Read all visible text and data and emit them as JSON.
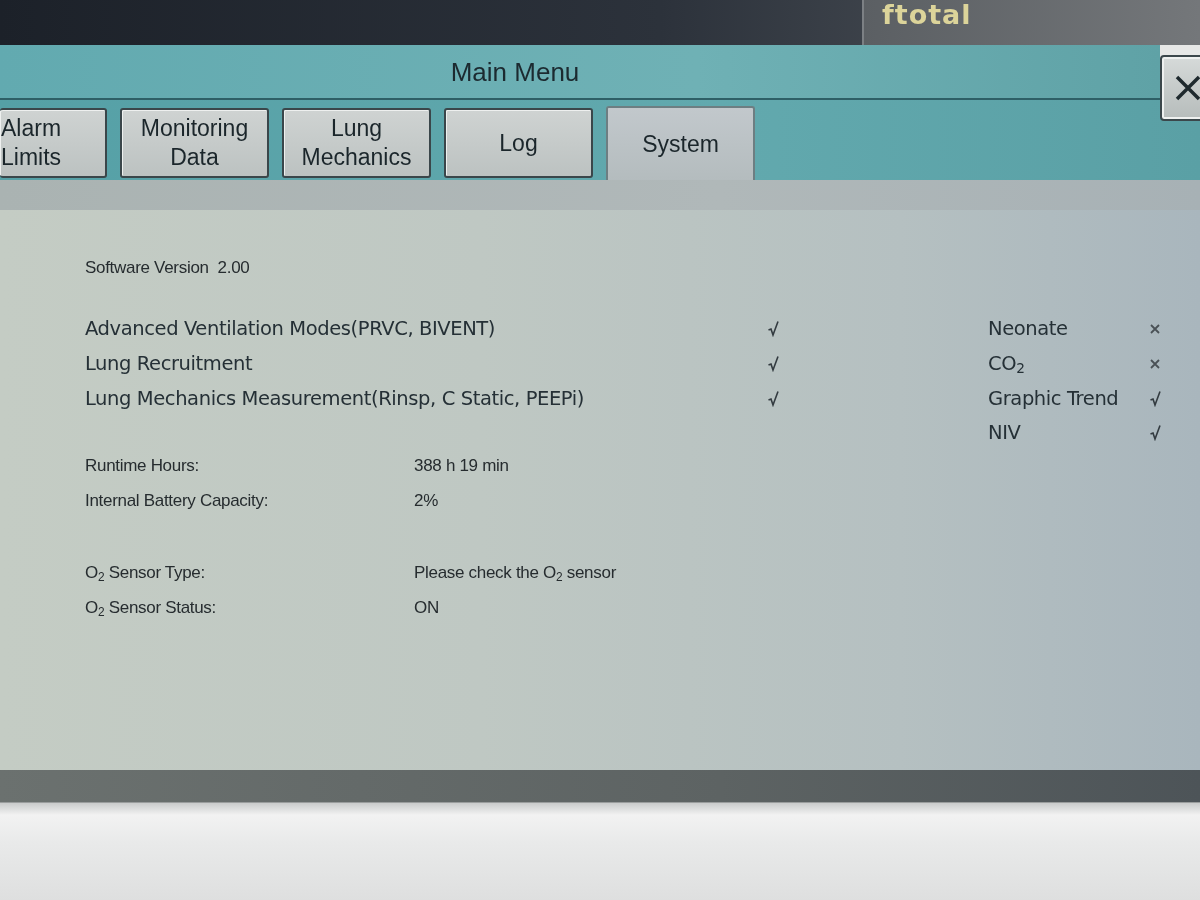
{
  "top_bar": {
    "label": "ftotal"
  },
  "menu": {
    "title": "Main Menu"
  },
  "tabs": [
    {
      "label": "Alarm\nLimits",
      "selected": false
    },
    {
      "label": "Monitoring\nData",
      "selected": false
    },
    {
      "label": "Lung\nMechanics",
      "selected": false
    },
    {
      "label": "Log",
      "selected": false
    },
    {
      "label": "System",
      "selected": true
    }
  ],
  "software_version": "Software Version  2.00",
  "features": [
    {
      "name": "Advanced Ventilation Modes(PRVC, BIVENT)",
      "enabled": true
    },
    {
      "name": "Lung Recruitment",
      "enabled": true
    },
    {
      "name": "Lung Mechanics Measurement(Rinsp, C Static, PEEPi)",
      "enabled": true
    }
  ],
  "options": [
    {
      "name": "Neonate",
      "enabled": false
    },
    {
      "name": "CO$_{2}$",
      "enabled": false
    },
    {
      "name": "Graphic Trend",
      "enabled": true
    },
    {
      "name": "NIV",
      "enabled": true
    }
  ],
  "info_groups": [
    [
      {
        "label": "Runtime Hours:",
        "value": "388 h 19 min"
      },
      {
        "label": "Internal Battery Capacity:",
        "value": "2%"
      }
    ],
    [
      {
        "label": "O$_{2}$ Sensor Type:",
        "value": "Please check the O$_{2}$ sensor"
      },
      {
        "label": "O$_{2}$ Sensor Status:",
        "value": "ON"
      }
    ]
  ]
}
